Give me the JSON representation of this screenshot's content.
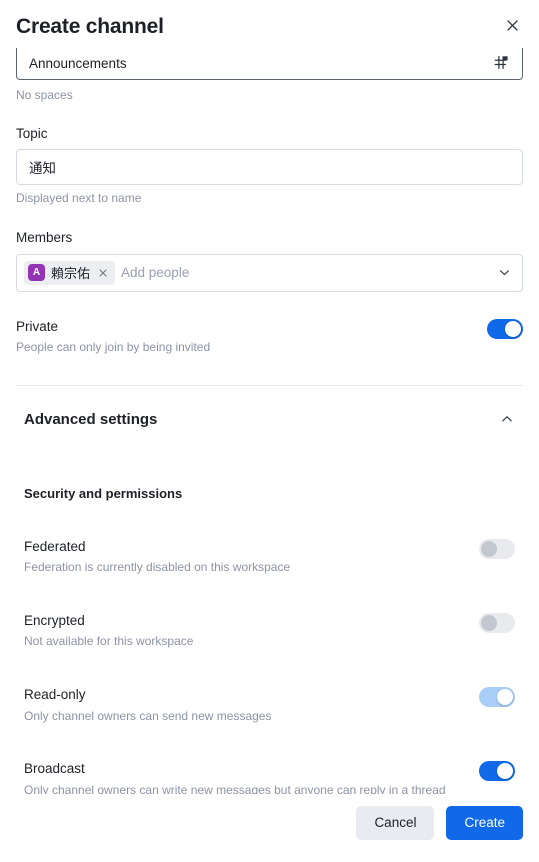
{
  "dialog": {
    "title": "Create channel",
    "close_label": "Close"
  },
  "name_field": {
    "value": "Announcements",
    "hint": "No spaces",
    "icon": "channel-hash-icon"
  },
  "topic_field": {
    "label": "Topic",
    "value": "通知",
    "hint": "Displayed next to name"
  },
  "members_field": {
    "label": "Members",
    "placeholder": "Add people",
    "chevron_icon": "chevron-down-icon",
    "chips": [
      {
        "initial": "A",
        "name": "賴宗佑",
        "avatar_color": "#9333b5",
        "remove_icon": "close-icon"
      }
    ]
  },
  "private_setting": {
    "title": "Private",
    "subtitle": "People can only join by being invited",
    "enabled": true,
    "disabled": false
  },
  "advanced": {
    "title": "Advanced settings",
    "expanded": true,
    "chevron_icon": "chevron-up-icon",
    "section_title": "Security and permissions",
    "settings": [
      {
        "title": "Federated",
        "subtitle": "Federation is currently disabled on this workspace",
        "enabled": false,
        "disabled": true
      },
      {
        "title": "Encrypted",
        "subtitle": "Not available for this workspace",
        "enabled": false,
        "disabled": true
      },
      {
        "title": "Read-only",
        "subtitle": "Only channel owners can send new messages",
        "enabled": true,
        "disabled": true
      },
      {
        "title": "Broadcast",
        "subtitle": "Only channel owners can write new messages but anyone can reply in a thread",
        "enabled": true,
        "disabled": false
      }
    ]
  },
  "footer": {
    "cancel_label": "Cancel",
    "create_label": "Create"
  },
  "colors": {
    "accent": "#1069e8",
    "accent_muted": "#a8cdf7",
    "avatar": "#9333b5",
    "text": "#1d2026",
    "muted_text": "#8d93a5",
    "border": "#d6dae3",
    "chip_bg": "#eceef2",
    "cancel_bg": "#e8ebef"
  }
}
